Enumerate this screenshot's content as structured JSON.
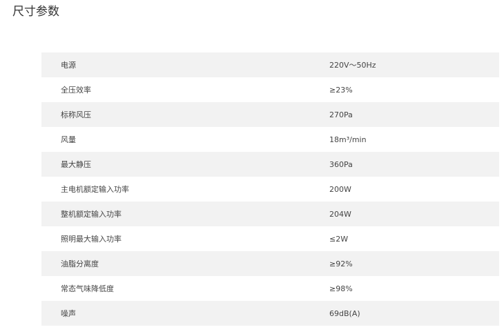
{
  "page": {
    "title": "尺寸参数"
  },
  "specs": [
    {
      "label": "电源",
      "value": "220V～50Hz"
    },
    {
      "label": "全压效率",
      "value": "≥23%"
    },
    {
      "label": "标称风压",
      "value": "270Pa"
    },
    {
      "label": "风量",
      "value": "18m³/min"
    },
    {
      "label": "最大静压",
      "value": "360Pa"
    },
    {
      "label": "主电机额定输入功率",
      "value": "200W"
    },
    {
      "label": "整机额定输入功率",
      "value": "204W"
    },
    {
      "label": "照明最大输入功率",
      "value": "≤2W"
    },
    {
      "label": "油脂分离度",
      "value": "≥92%"
    },
    {
      "label": "常态气味降低度",
      "value": "≥98%"
    },
    {
      "label": "噪声",
      "value": "69dB(A)"
    }
  ],
  "colors": {
    "row_stripe": "#f2f2f2",
    "row_plain": "#ffffff",
    "text": "#444444"
  }
}
